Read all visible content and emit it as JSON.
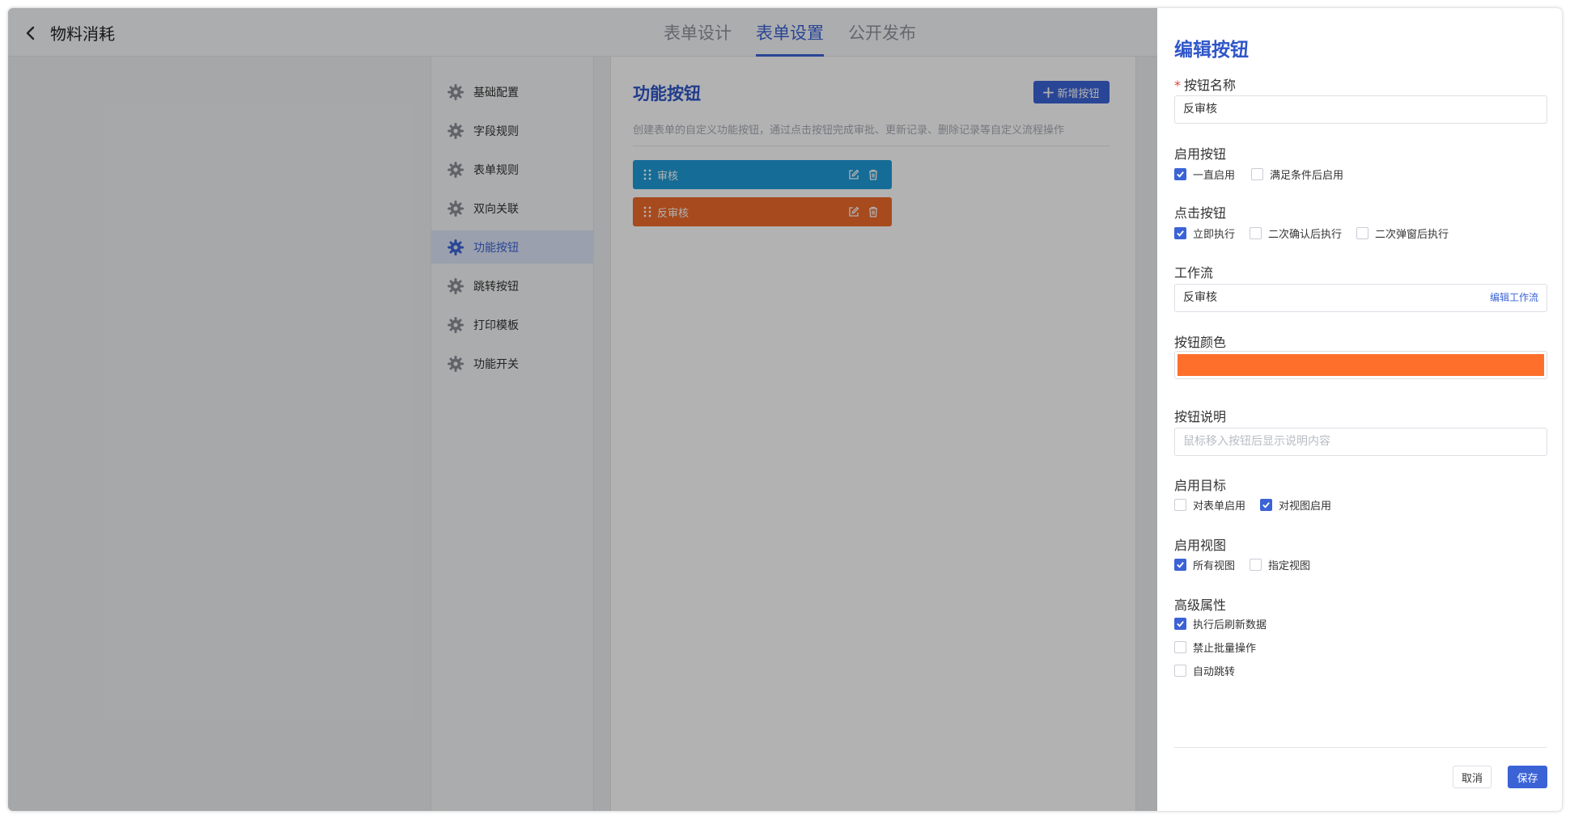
{
  "header": {
    "back_icon": "chevron-left-icon",
    "title": "物料消耗",
    "tabs": [
      {
        "label": "表单设计"
      },
      {
        "label": "表单设置"
      },
      {
        "label": "公开发布"
      }
    ],
    "active_tab": "表单设置"
  },
  "sidebar": {
    "icon": "gear-icon",
    "items": [
      {
        "label": "基础配置"
      },
      {
        "label": "字段规则"
      },
      {
        "label": "表单规则"
      },
      {
        "label": "双向关联"
      },
      {
        "label": "功能按钮"
      },
      {
        "label": "跳转按钮"
      },
      {
        "label": "打印模板"
      },
      {
        "label": "功能开关"
      }
    ],
    "active": "功能按钮"
  },
  "main": {
    "title": "功能按钮",
    "add_button": "新增按钮",
    "description": "创建表单的自定义功能按钮，通过点击按钮完成审批、更新记录、删除记录等自定义流程操作",
    "buttons": [
      {
        "label": "审核",
        "color": "#1f9bd8"
      },
      {
        "label": "反审核",
        "color": "#f06a2a"
      }
    ]
  },
  "drawer": {
    "title": "编辑按钮",
    "name_label": "按钮名称",
    "name_value": "反审核",
    "enable_label": "启用按钮",
    "enable_options": [
      {
        "label": "一直启用",
        "checked": true
      },
      {
        "label": "满足条件后启用",
        "checked": false
      }
    ],
    "click_label": "点击按钮",
    "click_options": [
      {
        "label": "立即执行",
        "checked": true
      },
      {
        "label": "二次确认后执行",
        "checked": false
      },
      {
        "label": "二次弹窗后执行",
        "checked": false
      }
    ],
    "workflow_label": "工作流",
    "workflow_value": "反审核",
    "workflow_link": "编辑工作流",
    "color_label": "按钮颜色",
    "color_value": "#ff6f2c",
    "desc_label": "按钮说明",
    "desc_placeholder": "鼠标移入按钮后显示说明内容",
    "target_label": "启用目标",
    "target_options": [
      {
        "label": "对表单启用",
        "checked": false
      },
      {
        "label": "对视图启用",
        "checked": true
      }
    ],
    "view_label": "启用视图",
    "view_options": [
      {
        "label": "所有视图",
        "checked": true
      },
      {
        "label": "指定视图",
        "checked": false
      }
    ],
    "advanced_label": "高级属性",
    "advanced_options": [
      {
        "label": "执行后刷新数据",
        "checked": true
      },
      {
        "label": "禁止批量操作",
        "checked": false
      },
      {
        "label": "自动跳转",
        "checked": false
      }
    ],
    "cancel": "取消",
    "save": "保存"
  },
  "colors": {
    "primary": "#3b63d6",
    "overlay": "rgba(0,0,0,0.30)"
  }
}
